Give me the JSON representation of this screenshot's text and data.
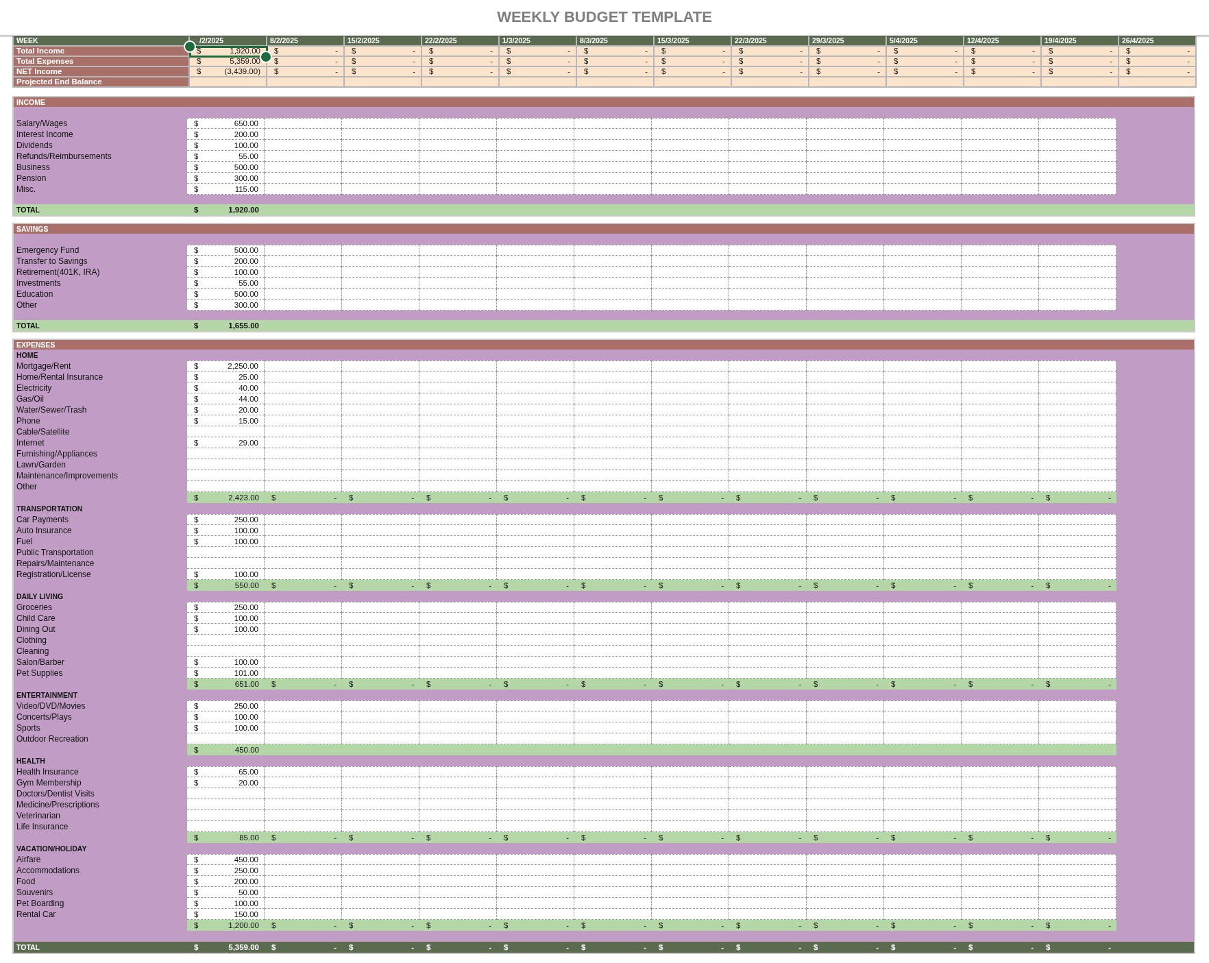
{
  "title": "WEEKLY BUDGET TEMPLATE",
  "summary": {
    "week_label": "WEEK",
    "weeks": [
      "/2/2025",
      "8/2/2025",
      "15/2/2025",
      "22/2/2025",
      "1/3/2025",
      "8/3/2025",
      "15/3/2025",
      "22/3/2025",
      "29/3/2025",
      "5/4/2025",
      "12/4/2025",
      "19/4/2025",
      "26/4/2025"
    ],
    "rows": [
      {
        "label": "Total Income",
        "cells": [
          {
            "currency": "$",
            "amount": "1,920.00",
            "selected": true
          },
          {
            "currency": "$",
            "amount": "-",
            "selected": false
          },
          {
            "currency": "$",
            "amount": "-",
            "selected": false
          },
          {
            "currency": "$",
            "amount": "-",
            "selected": false
          },
          {
            "currency": "$",
            "amount": "-",
            "selected": false
          },
          {
            "currency": "$",
            "amount": "-",
            "selected": false
          },
          {
            "currency": "$",
            "amount": "-",
            "selected": false
          },
          {
            "currency": "$",
            "amount": "-",
            "selected": false
          },
          {
            "currency": "$",
            "amount": "-",
            "selected": false
          },
          {
            "currency": "$",
            "amount": "-",
            "selected": false
          },
          {
            "currency": "$",
            "amount": "-",
            "selected": false
          },
          {
            "currency": "$",
            "amount": "-",
            "selected": false
          },
          {
            "currency": "$",
            "amount": "-",
            "selected": false
          }
        ]
      },
      {
        "label": "Total Expenses",
        "cells": [
          {
            "currency": "$",
            "amount": "5,359.00",
            "selected": false
          },
          {
            "currency": "$",
            "amount": "-",
            "selected": false
          },
          {
            "currency": "$",
            "amount": "-",
            "selected": false
          },
          {
            "currency": "$",
            "amount": "-",
            "selected": false
          },
          {
            "currency": "$",
            "amount": "-",
            "selected": false
          },
          {
            "currency": "$",
            "amount": "-",
            "selected": false
          },
          {
            "currency": "$",
            "amount": "-",
            "selected": false
          },
          {
            "currency": "$",
            "amount": "-",
            "selected": false
          },
          {
            "currency": "$",
            "amount": "-",
            "selected": false
          },
          {
            "currency": "$",
            "amount": "-",
            "selected": false
          },
          {
            "currency": "$",
            "amount": "-",
            "selected": false
          },
          {
            "currency": "$",
            "amount": "-",
            "selected": false
          },
          {
            "currency": "$",
            "amount": "-",
            "selected": false
          }
        ]
      },
      {
        "label": "NET Income",
        "cells": [
          {
            "currency": "$",
            "amount": "(3,439.00)",
            "selected": false
          },
          {
            "currency": "$",
            "amount": "-",
            "selected": false
          },
          {
            "currency": "$",
            "amount": "-",
            "selected": false
          },
          {
            "currency": "$",
            "amount": "-",
            "selected": false
          },
          {
            "currency": "$",
            "amount": "-",
            "selected": false
          },
          {
            "currency": "$",
            "amount": "-",
            "selected": false
          },
          {
            "currency": "$",
            "amount": "-",
            "selected": false
          },
          {
            "currency": "$",
            "amount": "-",
            "selected": false
          },
          {
            "currency": "$",
            "amount": "-",
            "selected": false
          },
          {
            "currency": "$",
            "amount": "-",
            "selected": false
          },
          {
            "currency": "$",
            "amount": "-",
            "selected": false
          },
          {
            "currency": "$",
            "amount": "-",
            "selected": false
          },
          {
            "currency": "$",
            "amount": "-",
            "selected": false
          }
        ]
      },
      {
        "label": "Projected End Balance"
      }
    ]
  },
  "sections": [
    {
      "kind": "simple",
      "title": "INCOME",
      "items": [
        {
          "label": "Salary/Wages",
          "currency": "$",
          "amount": "650.00"
        },
        {
          "label": "Interest Income",
          "currency": "$",
          "amount": "200.00"
        },
        {
          "label": "Dividends",
          "currency": "$",
          "amount": "100.00"
        },
        {
          "label": "Refunds/Reimbursements",
          "currency": "$",
          "amount": "55.00"
        },
        {
          "label": "Business",
          "currency": "$",
          "amount": "500.00"
        },
        {
          "label": "Pension",
          "currency": "$",
          "amount": "300.00"
        },
        {
          "label": "Misc.",
          "currency": "$",
          "amount": "115.00"
        }
      ],
      "total": {
        "label": "TOTAL",
        "cells": [
          {
            "currency": "$",
            "amount": "1,920.00"
          }
        ]
      }
    },
    {
      "kind": "simple",
      "title": "SAVINGS",
      "items": [
        {
          "label": "Emergency Fund",
          "currency": "$",
          "amount": "500.00"
        },
        {
          "label": "Transfer to Savings",
          "currency": "$",
          "amount": "200.00"
        },
        {
          "label": "Retirement(401K, IRA)",
          "currency": "$",
          "amount": "100.00"
        },
        {
          "label": "Investments",
          "currency": "$",
          "amount": "55.00"
        },
        {
          "label": "Education",
          "currency": "$",
          "amount": "500.00"
        },
        {
          "label": "Other",
          "currency": "$",
          "amount": "300.00"
        }
      ],
      "total": {
        "label": "TOTAL",
        "cells": [
          {
            "currency": "$",
            "amount": "1,655.00"
          }
        ]
      }
    },
    {
      "kind": "grouped",
      "title": "EXPENSES",
      "groups": [
        {
          "title": "HOME",
          "items": [
            {
              "label": "Mortgage/Rent",
              "currency": "$",
              "amount": "2,250.00"
            },
            {
              "label": "Home/Rental Insurance",
              "currency": "$",
              "amount": "25.00"
            },
            {
              "label": "Electricity",
              "currency": "$",
              "amount": "40.00"
            },
            {
              "label": "Gas/Oil",
              "currency": "$",
              "amount": "44.00"
            },
            {
              "label": "Water/Sewer/Trash",
              "currency": "$",
              "amount": "20.00"
            },
            {
              "label": "Phone",
              "currency": "$",
              "amount": "15.00"
            },
            {
              "label": "Cable/Satellite"
            },
            {
              "label": "Internet",
              "currency": "$",
              "amount": "29.00"
            },
            {
              "label": "Furnishing/Appliances"
            },
            {
              "label": "Lawn/Garden"
            },
            {
              "label": "Maintenance/Improvements"
            },
            {
              "label": "Other"
            }
          ],
          "subtotal": [
            {
              "currency": "$",
              "amount": "2,423.00"
            },
            {
              "currency": "$",
              "amount": "-"
            },
            {
              "currency": "$",
              "amount": "-"
            },
            {
              "currency": "$",
              "amount": "-"
            },
            {
              "currency": "$",
              "amount": "-"
            },
            {
              "currency": "$",
              "amount": "-"
            },
            {
              "currency": "$",
              "amount": "-"
            },
            {
              "currency": "$",
              "amount": "-"
            },
            {
              "currency": "$",
              "amount": "-"
            },
            {
              "currency": "$",
              "amount": "-"
            },
            {
              "currency": "$",
              "amount": "-"
            },
            {
              "currency": "$",
              "amount": "-"
            }
          ]
        },
        {
          "title": "TRANSPORTATION",
          "items": [
            {
              "label": "Car Payments",
              "currency": "$",
              "amount": "250.00"
            },
            {
              "label": "Auto Insurance",
              "currency": "$",
              "amount": "100.00"
            },
            {
              "label": "Fuel",
              "currency": "$",
              "amount": "100.00"
            },
            {
              "label": "Public Transportation"
            },
            {
              "label": "Repairs/Maintenance"
            },
            {
              "label": "Registration/License",
              "currency": "$",
              "amount": "100.00"
            }
          ],
          "subtotal": [
            {
              "currency": "$",
              "amount": "550.00"
            },
            {
              "currency": "$",
              "amount": "-"
            },
            {
              "currency": "$",
              "amount": "-"
            },
            {
              "currency": "$",
              "amount": "-"
            },
            {
              "currency": "$",
              "amount": "-"
            },
            {
              "currency": "$",
              "amount": "-"
            },
            {
              "currency": "$",
              "amount": "-"
            },
            {
              "currency": "$",
              "amount": "-"
            },
            {
              "currency": "$",
              "amount": "-"
            },
            {
              "currency": "$",
              "amount": "-"
            },
            {
              "currency": "$",
              "amount": "-"
            },
            {
              "currency": "$",
              "amount": "-"
            }
          ]
        },
        {
          "title": "DAILY LIVING",
          "items": [
            {
              "label": "Groceries",
              "currency": "$",
              "amount": "250.00"
            },
            {
              "label": "Child Care",
              "currency": "$",
              "amount": "100.00"
            },
            {
              "label": "Dining Out",
              "currency": "$",
              "amount": "100.00"
            },
            {
              "label": "Clothing"
            },
            {
              "label": "Cleaning"
            },
            {
              "label": "Salon/Barber",
              "currency": "$",
              "amount": "100.00"
            },
            {
              "label": "Pet Supplies",
              "currency": "$",
              "amount": "101.00"
            }
          ],
          "subtotal": [
            {
              "currency": "$",
              "amount": "651.00"
            },
            {
              "currency": "$",
              "amount": "-"
            },
            {
              "currency": "$",
              "amount": "-"
            },
            {
              "currency": "$",
              "amount": "-"
            },
            {
              "currency": "$",
              "amount": "-"
            },
            {
              "currency": "$",
              "amount": "-"
            },
            {
              "currency": "$",
              "amount": "-"
            },
            {
              "currency": "$",
              "amount": "-"
            },
            {
              "currency": "$",
              "amount": "-"
            },
            {
              "currency": "$",
              "amount": "-"
            },
            {
              "currency": "$",
              "amount": "-"
            },
            {
              "currency": "$",
              "amount": "-"
            }
          ]
        },
        {
          "title": "ENTERTAINMENT",
          "items": [
            {
              "label": "Video/DVD/Movies",
              "currency": "$",
              "amount": "250.00"
            },
            {
              "label": "Concerts/Plays",
              "currency": "$",
              "amount": "100.00"
            },
            {
              "label": "Sports",
              "currency": "$",
              "amount": "100.00"
            },
            {
              "label": "Outdoor Recreation"
            }
          ],
          "subtotal": [
            {
              "currency": "$",
              "amount": "450.00"
            }
          ]
        },
        {
          "title": "HEALTH",
          "items": [
            {
              "label": "Health Insurance",
              "currency": "$",
              "amount": "65.00"
            },
            {
              "label": "Gym Membership",
              "currency": "$",
              "amount": "20.00"
            },
            {
              "label": "Doctors/Dentist Visits"
            },
            {
              "label": "Medicine/Prescriptions"
            },
            {
              "label": "Veterinarian"
            },
            {
              "label": "Life Insurance"
            }
          ],
          "subtotal": [
            {
              "currency": "$",
              "amount": "85.00"
            },
            {
              "currency": "$",
              "amount": "-"
            },
            {
              "currency": "$",
              "amount": "-"
            },
            {
              "currency": "$",
              "amount": "-"
            },
            {
              "currency": "$",
              "amount": "-"
            },
            {
              "currency": "$",
              "amount": "-"
            },
            {
              "currency": "$",
              "amount": "-"
            },
            {
              "currency": "$",
              "amount": "-"
            },
            {
              "currency": "$",
              "amount": "-"
            },
            {
              "currency": "$",
              "amount": "-"
            },
            {
              "currency": "$",
              "amount": "-"
            },
            {
              "currency": "$",
              "amount": "-"
            }
          ]
        },
        {
          "title": "VACATION/HOLIDAY",
          "items": [
            {
              "label": "Airfare",
              "currency": "$",
              "amount": "450.00"
            },
            {
              "label": "Accommodations",
              "currency": "$",
              "amount": "250.00"
            },
            {
              "label": "Food",
              "currency": "$",
              "amount": "200.00"
            },
            {
              "label": "Souvenirs",
              "currency": "$",
              "amount": "50.00"
            },
            {
              "label": "Pet Boarding",
              "currency": "$",
              "amount": "100.00"
            },
            {
              "label": "Rental Car",
              "currency": "$",
              "amount": "150.00"
            }
          ],
          "subtotal": [
            {
              "currency": "$",
              "amount": "1,200.00"
            },
            {
              "currency": "$",
              "amount": "-"
            },
            {
              "currency": "$",
              "amount": "-"
            },
            {
              "currency": "$",
              "amount": "-"
            },
            {
              "currency": "$",
              "amount": "-"
            },
            {
              "currency": "$",
              "amount": "-"
            },
            {
              "currency": "$",
              "amount": "-"
            },
            {
              "currency": "$",
              "amount": "-"
            },
            {
              "currency": "$",
              "amount": "-"
            },
            {
              "currency": "$",
              "amount": "-"
            },
            {
              "currency": "$",
              "amount": "-"
            },
            {
              "currency": "$",
              "amount": "-"
            }
          ]
        }
      ],
      "total": {
        "label": "TOTAL",
        "cells": [
          {
            "currency": "$",
            "amount": "5,359.00"
          },
          {
            "currency": "$",
            "amount": "-"
          },
          {
            "currency": "$",
            "amount": "-"
          },
          {
            "currency": "$",
            "amount": "-"
          },
          {
            "currency": "$",
            "amount": "-"
          },
          {
            "currency": "$",
            "amount": "-"
          },
          {
            "currency": "$",
            "amount": "-"
          },
          {
            "currency": "$",
            "amount": "-"
          },
          {
            "currency": "$",
            "amount": "-"
          },
          {
            "currency": "$",
            "amount": "-"
          },
          {
            "currency": "$",
            "amount": "-"
          },
          {
            "currency": "$",
            "amount": "-"
          }
        ]
      }
    }
  ]
}
